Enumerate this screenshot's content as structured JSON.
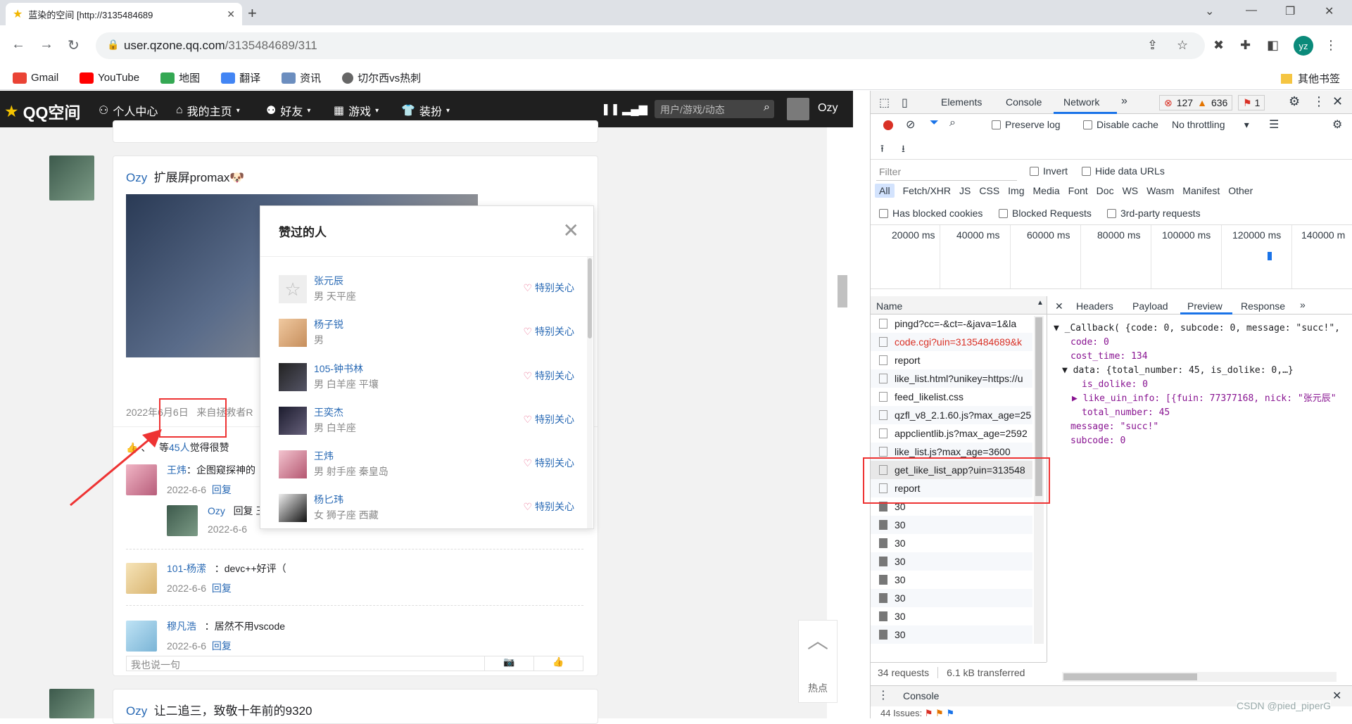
{
  "browser": {
    "tab_title": "蓝染的空间 [http://3135484689",
    "url_host": "user.qzone.qq.com",
    "url_path": "/3135484689/311",
    "profile_initials": "yz",
    "bookmarks": [
      "Gmail",
      "YouTube",
      "地图",
      "翻译",
      "资讯",
      "切尔西vs热刺"
    ],
    "other_bookmarks": "其他书签"
  },
  "qzone": {
    "logo": "QQ空间",
    "nav": [
      "个人中心",
      "我的主页",
      "好友",
      "游戏",
      "装扮"
    ],
    "search_placeholder": "用户/游戏/动态",
    "username": "Ozy"
  },
  "post1": {
    "author": "Ozy",
    "text": "扩展屏promax",
    "date": "2022年6月6日",
    "source": "来自拯救者R",
    "likes_prefix": "、",
    "likes_mid": "等",
    "likes_count": "45人",
    "likes_suffix": "觉得很赞",
    "comments": [
      {
        "name": "王炜",
        "text": "：企图窥探神的",
        "date": "2022-6-6",
        "reply": "回复"
      },
      {
        "name": "Ozy",
        "text": "回复 王",
        "date": "2022-6-6",
        "reply": ""
      },
      {
        "name": "101-杨潆",
        "text": "：devc++好评（",
        "date": "2022-6-6",
        "reply": "回复"
      },
      {
        "name": "穆凡浩",
        "text": "：居然不用vscode",
        "date": "2022-6-6",
        "reply": "回复"
      }
    ],
    "comment_placeholder": "我也说一句"
  },
  "post2": {
    "author": "Ozy",
    "text": "让二追三，致敬十年前的9320"
  },
  "popup": {
    "title": "赞过的人",
    "follow_label": "特别关心",
    "people": [
      {
        "name": "张元辰",
        "info": "男 天平座"
      },
      {
        "name": "杨子锐",
        "info": "男"
      },
      {
        "name": "105-钟书林",
        "info": "男 白羊座 平壤"
      },
      {
        "name": "王奕杰",
        "info": "男 白羊座"
      },
      {
        "name": "王炜",
        "info": "男 射手座 秦皇岛"
      },
      {
        "name": "杨匕玮",
        "info": "女 狮子座 西藏"
      }
    ]
  },
  "backtop": {
    "label": "热点"
  },
  "devtools": {
    "tabs": [
      "Elements",
      "Console",
      "Network"
    ],
    "errors": "127",
    "warnings": "636",
    "issues": "1",
    "preserve_log": "Preserve log",
    "disable_cache": "Disable cache",
    "throttling": "No throttling",
    "filter_placeholder": "Filter",
    "invert": "Invert",
    "hide_data_urls": "Hide data URLs",
    "types": [
      "All",
      "Fetch/XHR",
      "JS",
      "CSS",
      "Img",
      "Media",
      "Font",
      "Doc",
      "WS",
      "Wasm",
      "Manifest",
      "Other"
    ],
    "has_blocked": "Has blocked cookies",
    "blocked_requests": "Blocked Requests",
    "third_party": "3rd-party requests",
    "timeline": [
      "20000 ms",
      "40000 ms",
      "60000 ms",
      "80000 ms",
      "100000 ms",
      "120000 ms",
      "140000 m"
    ],
    "name_header": "Name",
    "requests": [
      {
        "name": "pingd?cc=-&ct=-&java=1&la",
        "red": false
      },
      {
        "name": "code.cgi?uin=3135484689&k",
        "red": true
      },
      {
        "name": "report",
        "red": false
      },
      {
        "name": "like_list.html?unikey=https://u",
        "red": false
      },
      {
        "name": "feed_likelist.css",
        "red": false
      },
      {
        "name": "qzfl_v8_2.1.60.js?max_age=25",
        "red": false
      },
      {
        "name": "appclientlib.js?max_age=2592",
        "red": false
      },
      {
        "name": "like_list.js?max_age=3600",
        "red": false
      },
      {
        "name": "get_like_list_app?uin=313548",
        "red": false
      },
      {
        "name": "report",
        "red": false
      },
      {
        "name": "30",
        "red": false
      },
      {
        "name": "30",
        "red": false
      },
      {
        "name": "30",
        "red": false
      },
      {
        "name": "30",
        "red": false
      },
      {
        "name": "30",
        "red": false
      },
      {
        "name": "30",
        "red": false
      },
      {
        "name": "30",
        "red": false
      },
      {
        "name": "30",
        "red": false
      }
    ],
    "detail_tabs": [
      "Headers",
      "Payload",
      "Preview",
      "Response"
    ],
    "preview": [
      "▼ _Callback( {code: 0, subcode: 0, message: \"succ!\",",
      "code: 0",
      "cost_time: 134",
      "▼ data: {total_number: 45, is_dolike: 0,…}",
      "is_dolike: 0",
      "▶ like_uin_info: [{fuin: 77377168, nick: \"张元辰\"",
      "total_number: 45",
      "message: \"succ!\"",
      "subcode: 0"
    ],
    "requests_count": "34 requests",
    "transferred": "6.1 kB transferred",
    "drawer_console": "Console",
    "issues_line": "44 Issues: ",
    "watermark": "CSDN @pied_piperG"
  }
}
